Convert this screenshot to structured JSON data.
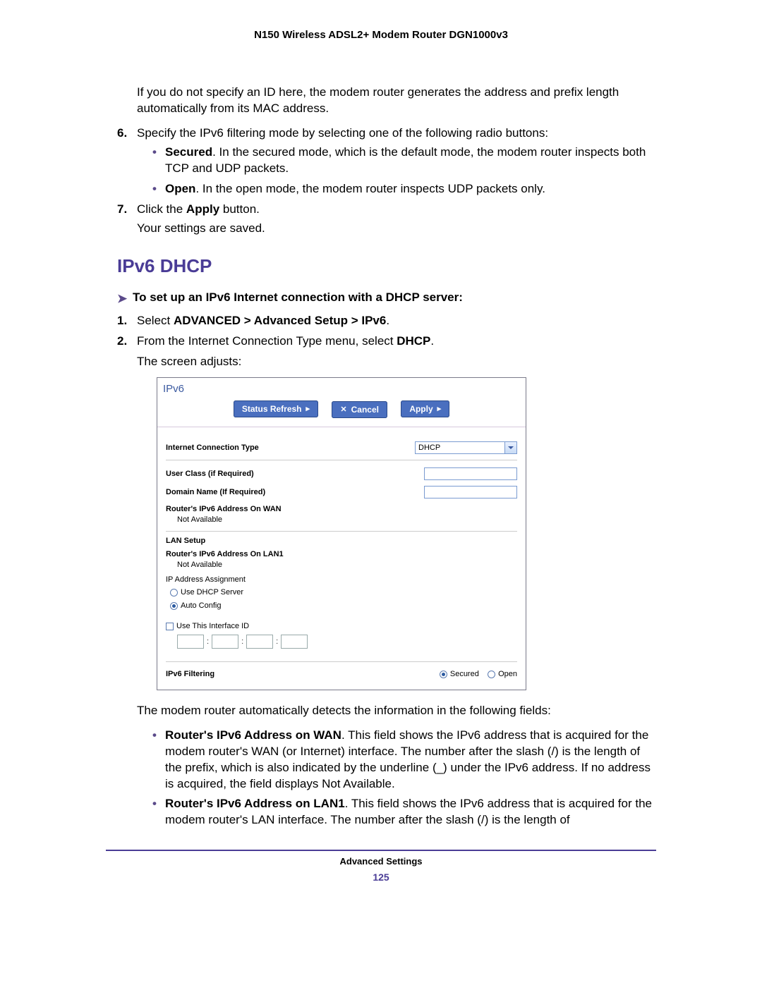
{
  "header": "N150 Wireless ADSL2+ Modem Router DGN1000v3",
  "intro_para": "If you do not specify an ID here, the modem router generates the address and prefix length automatically from its MAC address.",
  "step6_text": "Specify the IPv6 filtering mode by selecting one of the following radio buttons:",
  "step6_bullets": [
    {
      "bold": "Secured",
      "rest": ". In the secured mode, which is the default mode, the modem router inspects both TCP and UDP packets."
    },
    {
      "bold": "Open",
      "rest": ". In the open mode, the modem router inspects UDP packets only."
    }
  ],
  "step7_text_a": "Click the ",
  "step7_text_b": "Apply",
  "step7_text_c": " button.",
  "step7_result": "Your settings are saved.",
  "section_heading": "IPv6 DHCP",
  "task_line": "To set up an IPv6 Internet connection with a DHCP server:",
  "sub_step1_a": "Select ",
  "sub_step1_b": "ADVANCED > Advanced Setup > IPv6",
  "sub_step1_c": ".",
  "sub_step2_a": "From the Internet Connection Type menu, select ",
  "sub_step2_b": "DHCP",
  "sub_step2_c": ".",
  "sub_step2_result": "The screen adjusts:",
  "shot": {
    "title": "IPv6",
    "btn_refresh": "Status Refresh",
    "btn_cancel": "Cancel",
    "btn_apply": "Apply",
    "row_conn_type": "Internet Connection Type",
    "sel_value": "DHCP",
    "row_user_class": "User Class (if Required)",
    "row_domain": "Domain Name  (If Required)",
    "row_wan_addr": "Router's IPv6 Address On WAN",
    "not_available": "Not Available",
    "lan_setup": "LAN Setup",
    "row_lan_addr": "Router's IPv6 Address On LAN1",
    "ip_assign": "IP Address Assignment",
    "radio_dhcp": "Use DHCP Server",
    "radio_auto": "Auto Config",
    "chk_interface": "Use This Interface ID",
    "filtering": "IPv6 Filtering",
    "radio_secured": "Secured",
    "radio_open": "Open"
  },
  "after_shot_para": "The modem router automatically detects the information in the following fields:",
  "after_bullets": [
    {
      "bold": "Router's IPv6 Address on WAN",
      "rest": ". This field shows the IPv6 address that is acquired for the modem router's WAN (or Internet) interface. The number after the slash (/) is the length of the prefix, which is also indicated by the underline (_) under the IPv6 address. If no address is acquired, the field displays Not Available."
    },
    {
      "bold": "Router's IPv6 Address on LAN1",
      "rest": ". This field shows the IPv6 address that is acquired for the modem router's LAN interface. The number after the slash (/) is the length of"
    }
  ],
  "footer_label": "Advanced Settings",
  "page_number": "125"
}
